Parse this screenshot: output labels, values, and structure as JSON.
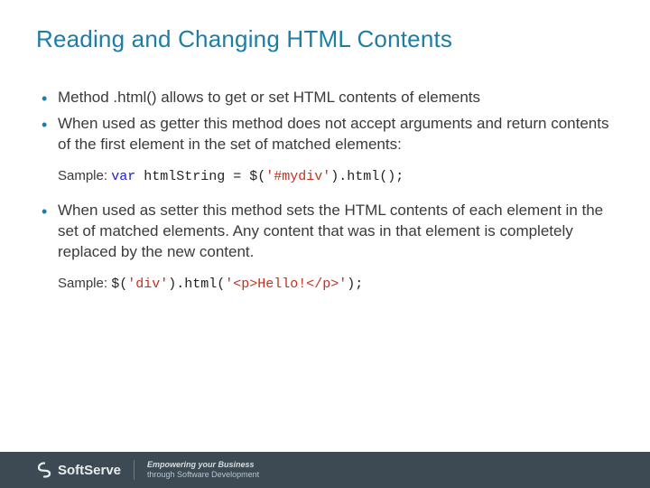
{
  "title": "Reading and Changing HTML Contents",
  "bullets": {
    "b1": "Method .html() allows to get or set HTML contents of elements",
    "b2": "When used as getter this method does not accept arguments and return contents of the first element in the set of matched elements:",
    "b3": "When used as setter this method sets the HTML contents of each element in the set of matched elements. Any content that was in that element is completely replaced by the new content."
  },
  "sample1": {
    "label": "Sample: ",
    "kw": "var",
    "p1": " htmlString = $(",
    "str": "'#mydiv'",
    "p2": ").html();"
  },
  "sample2": {
    "label": "Sample: ",
    "p1": "$(",
    "str1": "'div'",
    "p2": ").html(",
    "str2": "'<p>Hello!</p>'",
    "p3": ");"
  },
  "footer": {
    "brand": "SoftServe",
    "tag1": "Empowering your Business",
    "tag2": "through Software Development"
  }
}
